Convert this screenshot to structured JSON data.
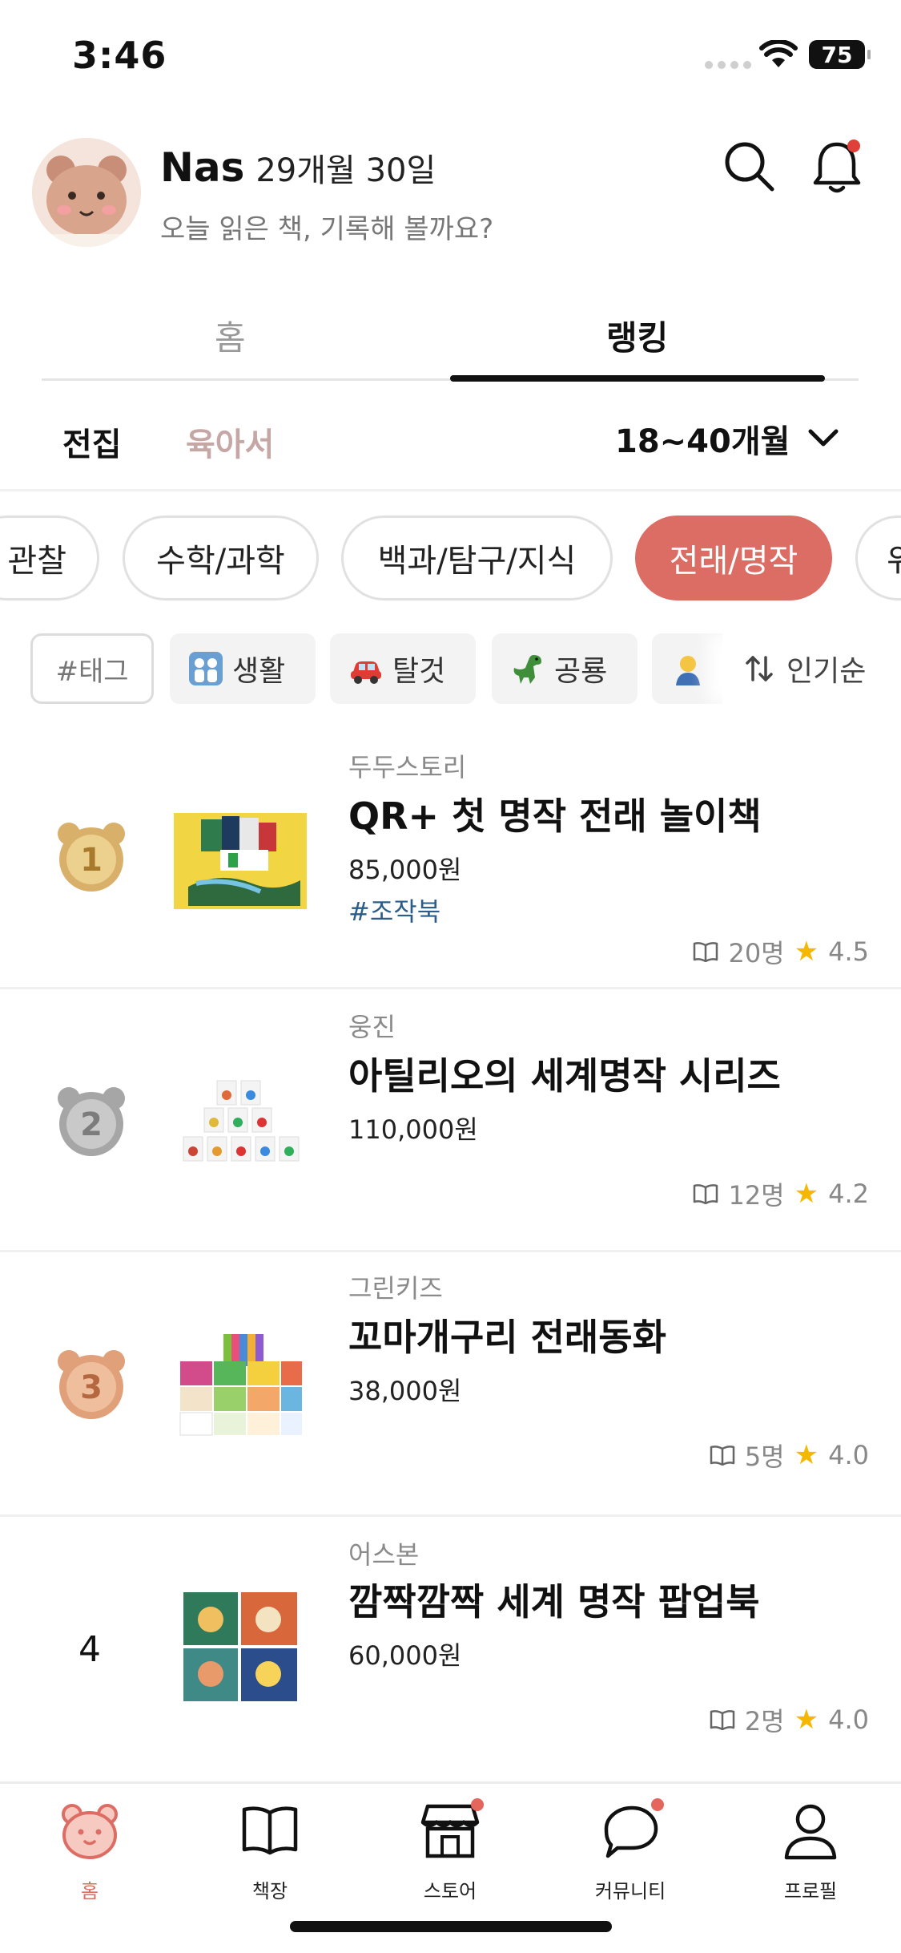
{
  "status_bar": {
    "time": "3:46",
    "battery": "75"
  },
  "header": {
    "user_name": "Nas",
    "user_age": "29개월 30일",
    "greeting": "오늘 읽은 책, 기록해 볼까요?"
  },
  "main_tabs": {
    "home": "홈",
    "ranking": "랭킹"
  },
  "sub_tabs": {
    "all": "전집",
    "parenting": "육아서",
    "age_range": "18~40개월"
  },
  "categories": [
    {
      "label": "관찰"
    },
    {
      "label": "수학/과학"
    },
    {
      "label": "백과/탐구/지식"
    },
    {
      "label": "전래/명작"
    },
    {
      "label": "위"
    }
  ],
  "tags": {
    "input_label": "#태그",
    "items": [
      {
        "label": "생활",
        "icon": "family-emoji"
      },
      {
        "label": "탈것",
        "icon": "car-emoji"
      },
      {
        "label": "공룡",
        "icon": "dinosaur-emoji"
      },
      {
        "label": "",
        "icon": "person-bowing-emoji"
      }
    ],
    "sort_label": "인기순"
  },
  "books": [
    {
      "rank": "1",
      "publisher": "두두스토리",
      "title": "QR+ 첫 명작 전래 놀이책",
      "price": "85,000원",
      "tag": "#조작북",
      "readers": "20명",
      "rating": "4.5",
      "medal_color": "#d9b06a"
    },
    {
      "rank": "2",
      "publisher": "웅진",
      "title": "아틸리오의 세계명작 시리즈",
      "price": "110,000원",
      "tag": "",
      "readers": "12명",
      "rating": "4.2",
      "medal_color": "#a6a6a6"
    },
    {
      "rank": "3",
      "publisher": "그린키즈",
      "title": "꼬마개구리 전래동화",
      "price": "38,000원",
      "tag": "",
      "readers": "5명",
      "rating": "4.0",
      "medal_color": "#e0a07a"
    },
    {
      "rank": "4",
      "publisher": "어스본",
      "title": "깜짝깜짝 세계 명작 팝업북",
      "price": "60,000원",
      "tag": "",
      "readers": "2명",
      "rating": "4.0",
      "medal_color": ""
    }
  ],
  "bottom_nav": [
    {
      "label": "홈",
      "icon": "bear-home-icon",
      "active": true
    },
    {
      "label": "책장",
      "icon": "book-icon"
    },
    {
      "label": "스토어",
      "icon": "store-icon"
    },
    {
      "label": "커뮤니티",
      "icon": "chat-icon"
    },
    {
      "label": "프로필",
      "icon": "profile-icon"
    }
  ],
  "colors": {
    "accent": "#dc6d64",
    "gold": "#d9b06a",
    "silver": "#a6a6a6",
    "bronze": "#e0a07a",
    "star": "#f5b800"
  }
}
